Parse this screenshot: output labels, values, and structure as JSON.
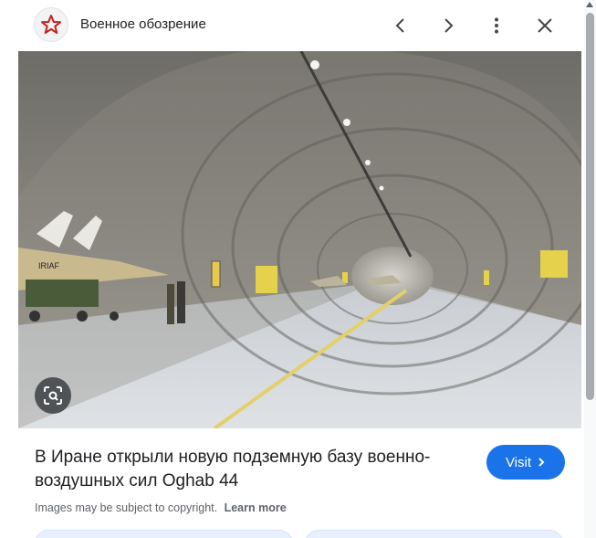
{
  "header": {
    "site_name": "Военное обозрение",
    "site_icon": "red-star-icon",
    "buttons": [
      "chevron-left-icon",
      "chevron-right-icon",
      "more-vert-icon",
      "close-icon"
    ]
  },
  "image": {
    "subject": "underground hangar",
    "lens_icon": "lens-search-icon",
    "aircraft_marking": "IRIAF"
  },
  "info": {
    "title": "В Иране открыли новую подземную базу военно-воздушных сил Oghab 44",
    "visit_label": "Visit",
    "copyright": "Images may be subject to copyright.",
    "learn_more": "Learn more"
  },
  "colors": {
    "accent": "#1a73e8",
    "star": "#c5221f",
    "text": "#202124",
    "muted": "#5f6368"
  }
}
